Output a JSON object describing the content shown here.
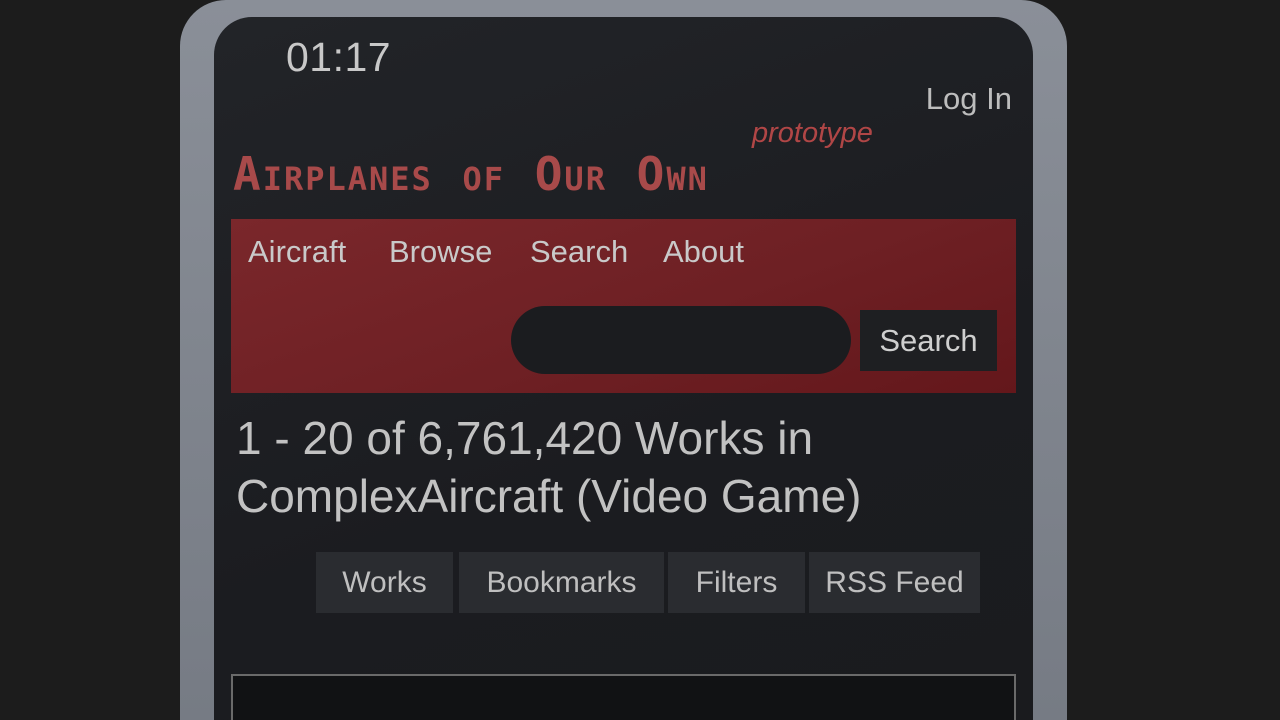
{
  "status_bar": {
    "time": "01:17"
  },
  "header": {
    "login_label": "Log In",
    "site_title": "Airplanes of Our Own",
    "site_subtitle": "prototype"
  },
  "nav": {
    "items": [
      {
        "label": "Aircraft"
      },
      {
        "label": "Browse"
      },
      {
        "label": "Search"
      },
      {
        "label": "About"
      }
    ],
    "search": {
      "value": "",
      "placeholder": "",
      "button_label": "Search"
    }
  },
  "main": {
    "heading": "1 - 20 of 6,761,420 Works in ComplexAircraft (Video Game)",
    "tabs": [
      {
        "label": "Works"
      },
      {
        "label": "Bookmarks"
      },
      {
        "label": "Filters"
      },
      {
        "label": "RSS Feed"
      }
    ]
  },
  "colors": {
    "accent_red": "#7a272b",
    "title_red": "#a84a4a",
    "background": "#1b1c20"
  }
}
